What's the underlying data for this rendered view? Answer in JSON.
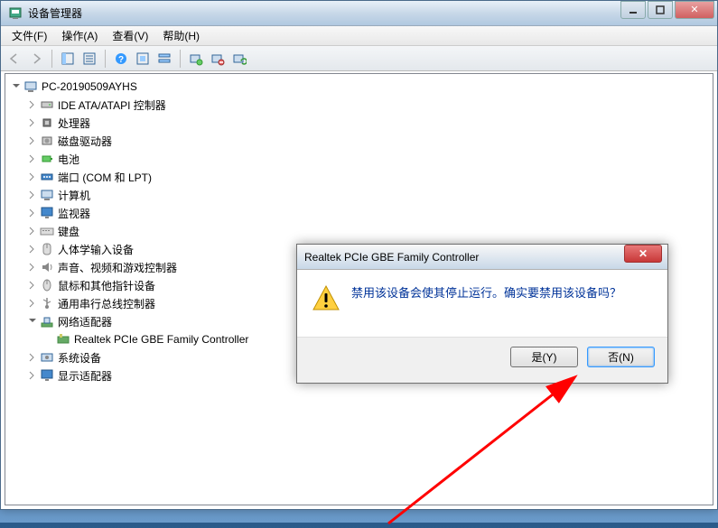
{
  "window": {
    "title": "设备管理器"
  },
  "menubar": {
    "file": "文件(F)",
    "action": "操作(A)",
    "view": "查看(V)",
    "help": "帮助(H)"
  },
  "tree": {
    "root": "PC-20190509AYHS",
    "items": [
      {
        "label": "IDE ATA/ATAPI 控制器",
        "icon": "drive"
      },
      {
        "label": "处理器",
        "icon": "cpu"
      },
      {
        "label": "磁盘驱动器",
        "icon": "disk"
      },
      {
        "label": "电池",
        "icon": "battery"
      },
      {
        "label": "端口 (COM 和 LPT)",
        "icon": "port"
      },
      {
        "label": "计算机",
        "icon": "computer"
      },
      {
        "label": "监视器",
        "icon": "monitor"
      },
      {
        "label": "键盘",
        "icon": "keyboard"
      },
      {
        "label": "人体学输入设备",
        "icon": "hid"
      },
      {
        "label": "声音、视频和游戏控制器",
        "icon": "sound"
      },
      {
        "label": "鼠标和其他指针设备",
        "icon": "mouse"
      },
      {
        "label": "通用串行总线控制器",
        "icon": "usb"
      },
      {
        "label": "网络适配器",
        "icon": "network",
        "expanded": true
      },
      {
        "label": "系统设备",
        "icon": "system"
      },
      {
        "label": "显示适配器",
        "icon": "display"
      }
    ],
    "network_child": "Realtek PCIe GBE Family Controller"
  },
  "dialog": {
    "title": "Realtek PCIe GBE Family Controller",
    "message": "禁用该设备会使其停止运行。确实要禁用该设备吗？",
    "yes": "是(Y)",
    "no": "否(N)"
  }
}
